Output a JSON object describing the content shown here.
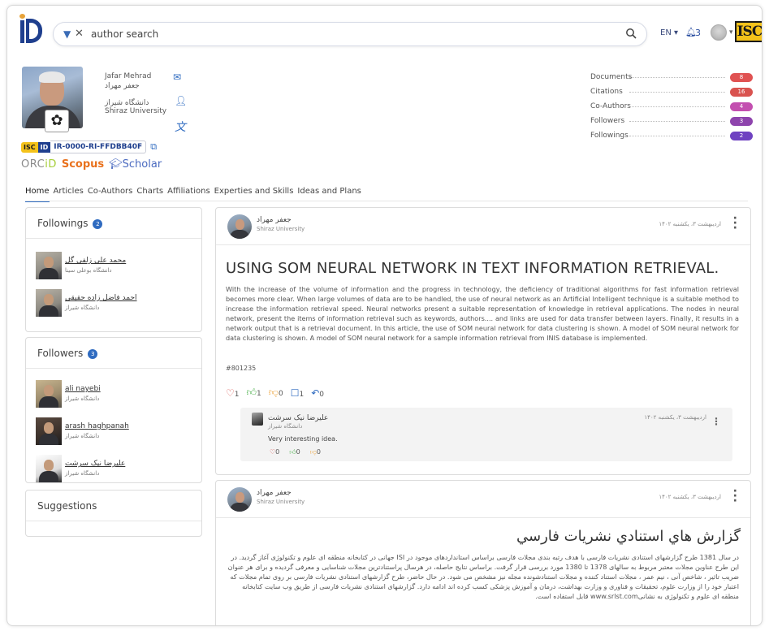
{
  "search": {
    "value": "author search"
  },
  "topbar": {
    "lang": "EN",
    "notif_count": "3",
    "brand": "ISC"
  },
  "profile": {
    "name_en": "Jafar Mehrad",
    "name_fa": "جعفر مهراد",
    "affil_fa": "دانشگاه شیراز",
    "affil_en": "Shiraz University",
    "isc_label": "ISC",
    "id_label": "ID",
    "isc_id": "IR-0000-RI-FFDBB40F",
    "orcid_a": "ORC",
    "orcid_b": "iD",
    "scopus": "Scopus",
    "scholar": "Scholar"
  },
  "stats": [
    {
      "label": "Documents",
      "value": "8",
      "color": "#e05252"
    },
    {
      "label": "Citations",
      "value": "16",
      "color": "#d9534f"
    },
    {
      "label": "Co-Authors",
      "value": "4",
      "color": "#c34fb0"
    },
    {
      "label": "Followers",
      "value": "3",
      "color": "#8e44ad"
    },
    {
      "label": "Followings",
      "value": "2",
      "color": "#6f42c1"
    }
  ],
  "tabs": [
    "Home",
    "Articles",
    "Co-Authors",
    "Charts",
    "Affiliations",
    "Experties and Skills",
    "Ideas and Plans"
  ],
  "followings": {
    "title": "Followings",
    "count": "2",
    "items": [
      {
        "name": "محمد علی زلفی گل",
        "aff": "دانشگاه بوعلی سینا"
      },
      {
        "name": "احمد فاضل زاده حقیقی",
        "aff": "دانشگاه شیراز"
      }
    ]
  },
  "followers": {
    "title": "Followers",
    "count": "3",
    "items": [
      {
        "name": "ali nayebi",
        "aff": "دانشگاه شیراز"
      },
      {
        "name": "arash haghpanah",
        "aff": "دانشگاه شیراز"
      },
      {
        "name": "علیرضا نیک سرشت",
        "aff": "دانشگاه شیراز"
      }
    ]
  },
  "suggestions": {
    "title": "Suggestions"
  },
  "post1": {
    "author": "جعفر مهراد",
    "affil": "Shiraz University",
    "date": "اردیبهشت ۳، یکشنبه ۱۴۰۲",
    "title": "USING SOM NEURAL NETWORK IN TEXT INFORMATION RETRIEVAL.",
    "body": "With the increase of the volume of information and the progress in technology, the deficiency of traditional algorithms for fast information retrieval becomes more clear. When large volumes of data are to be handled, the use of neural network as an Artificial Intelligent technique is a suitable method to increase the information retrieval speed. Neural networks present a suitable representation of knowledge in retrieval applications. The nodes in neural network, present the items of information retrieval such as keywords, authors.... and links are used for data transfer between layers. Finally, it results in a network output that is a retrieval document. In this article, the use of SOM neural network for data clustering is shown. A model of SOM neural network for data clustering is shown. A model of SOM neural network for a sample information retrieval from INIS database is implemented.",
    "tag": "#801235",
    "reactions": {
      "hearts": "1",
      "likes": "1",
      "dislikes": "0",
      "bookmarks": "1",
      "shares": "0"
    },
    "comment": {
      "author": "علیرضا نیک سرشت",
      "affil": "دانشگاه شیراز",
      "date": "اردیبهشت ۳، یکشنبه ۱۴۰۲",
      "text": "Very interesting idea.",
      "hearts": "0",
      "likes": "0",
      "dislikes": "0"
    }
  },
  "post2": {
    "author": "جعفر مهراد",
    "affil": "Shiraz University",
    "date": "اردیبهشت ۳، یکشنبه ۱۴۰۲",
    "title": "گزارش هاي استنادي نشريات فارسي",
    "body": "در سال 1381 طرح گزارشهای استنادی نشریات فارسی با هدف رتبه بندی مجلات فارسی براساس استانداردهای موجود در ISI جهانی در کتابخانه منطقه ای علوم و تکنولوژی آغاز گردید. در این طرح عناوین مجلات معتبر مربوط به سالهای 1378 تا 1380 مورد بررسی قرار گرفت. براساس نتایج حاصله، در هرسال پراستنادترین مجلات شناسایی و معرفی گردیده و برای هر عنوان ضریب تاثیر ، شاخص آنی ، نیم عمر ، مجلات استناد کننده و مجلات استنادشونده مجله نیز مشخص می شود. در حال حاضر، طرح گزارشهای استنادی نشریات فارسی بر روی تمام مجلات که اعتبار خود را از وزارت علوم، تحقیقات و فناوری و وزارت بهداشت، درمان و آموزش پزشکی کسب کرده اند ادامه دارد. گزارشهای استنادی نشریات فارسی از طریق وب سایت کتابخانه منطقه ای علوم و تکنولوژی به نشانیwww.srlst.com قابل استفاده است."
  }
}
